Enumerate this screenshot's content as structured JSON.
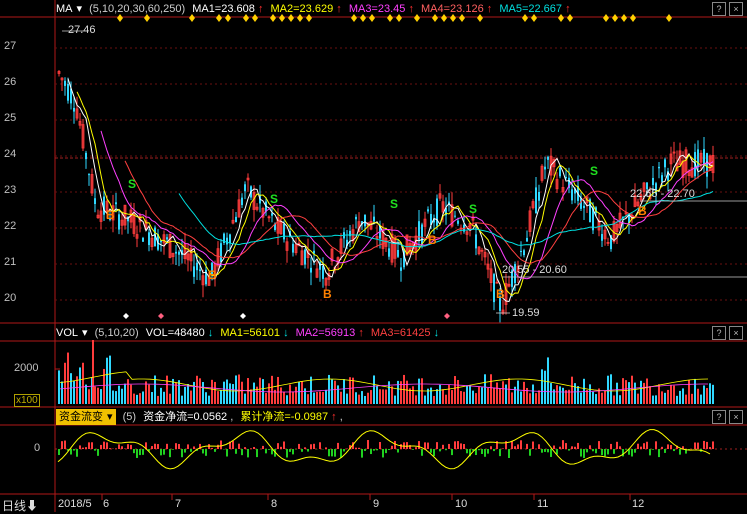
{
  "price_panel": {
    "indicator_menu": "MA",
    "params": "(5,10,20,30,60,250)",
    "ma1": "MA1=23.608",
    "ma2": "MA2=23.629",
    "ma3": "MA3=23.45",
    "ma4": "MA4=23.126",
    "ma5": "MA5=22.667",
    "up_arrow": "↑",
    "y_ticks": [
      "27",
      "26",
      "25",
      "24",
      "23",
      "22",
      "21",
      "20"
    ],
    "high_label": "27.46",
    "low_label": "19.59",
    "range_label_1": "20.55 - 20.60",
    "range_label_2": "22.65 - 22.70",
    "buy_marker": "B",
    "sell_marker": "S",
    "colors": {
      "ma1": "#ffffff",
      "ma2": "#ffff00",
      "ma3": "#ff00ff",
      "ma4": "#ff4040",
      "ma5": "#00ffff"
    }
  },
  "vol_panel": {
    "menu": "VOL",
    "params": "(5,10,20)",
    "vol": "VOL=48480",
    "ma1": "MA1=56101",
    "ma2": "MA2=56913",
    "ma3": "MA3=61425",
    "down_arrow": "↓",
    "up_arrow": "↑",
    "y_tick": "2000",
    "unit": "x100"
  },
  "flow_panel": {
    "menu": "资金流变",
    "params": "(5)",
    "net": "资金净流=0.0562",
    "cum": "累计净流=-0.0987",
    "up_arrow": "↑",
    "comma": ",",
    "y_tick": "0"
  },
  "footer": {
    "period": "日线",
    "start": "2018/5",
    "months": [
      "6",
      "7",
      "8",
      "9",
      "10",
      "11",
      "12"
    ]
  },
  "buttons": {
    "help": "?",
    "close": "×"
  }
}
